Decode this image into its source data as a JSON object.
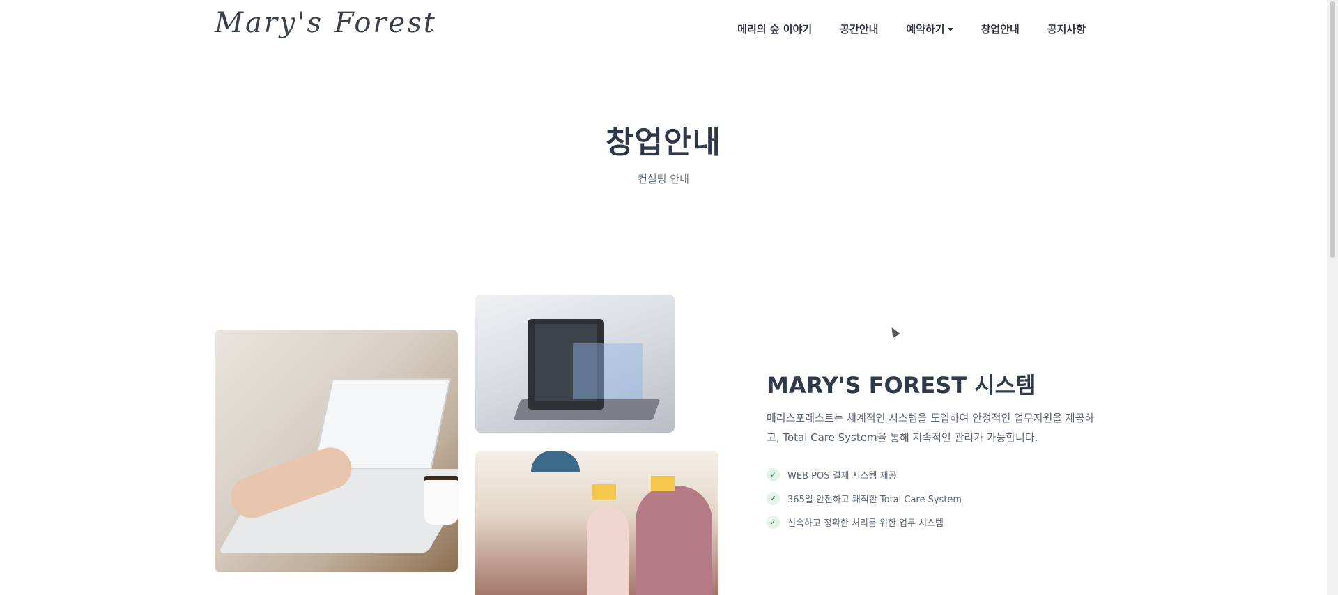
{
  "header": {
    "logo": "Mary's Forest",
    "nav": [
      {
        "label": "메리의 숲 이야기"
      },
      {
        "label": "공간안내"
      },
      {
        "label": "예약하기",
        "has_dropdown": true
      },
      {
        "label": "창업안내"
      },
      {
        "label": "공지사항"
      }
    ]
  },
  "hero": {
    "title": "창업안내",
    "subtitle": "컨설팅 안내"
  },
  "system": {
    "title": "MARY'S FOREST 시스템",
    "description": "메리스포레스트는 체계적인 시스템을 도입하여 안정적인 업무지원을 제공하고, Total Care System을 통해 지속적인 관리가 가능합니다.",
    "features": [
      "WEB POS 결제 시스템 제공",
      "365일 안전하고 쾌적한 Total Care System",
      "신속하고 정확한 처리를 위한 업무 시스템"
    ],
    "check_icon": "check-icon"
  },
  "colors": {
    "text_dark": "#2f3a4a",
    "text_muted": "#5c6474",
    "check_bg": "#e4f3ea",
    "check_fg": "#2f8a54"
  }
}
